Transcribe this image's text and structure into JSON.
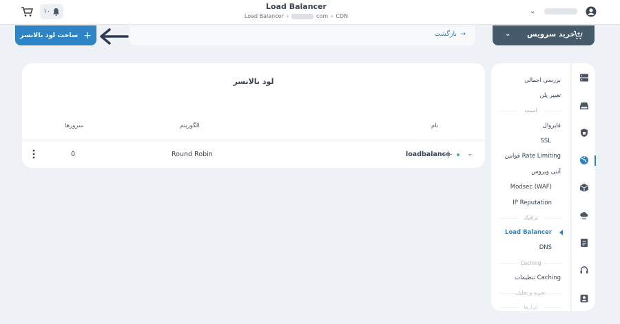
{
  "header": {
    "title": "Load Balancer",
    "breadcrumb": {
      "cdn": "CDN",
      "domain_suffix": "com",
      "current": "Load Balancer"
    },
    "notif_count": "۱۰"
  },
  "actions": {
    "create_button": "ساخت لود بالانسر",
    "back_link": "بازگشت",
    "buy_service": "خرید سرویس"
  },
  "card": {
    "title": "لود بالانسر",
    "columns": {
      "name": "نام",
      "algorithm": "الگوریتم",
      "servers": "سرورها"
    },
    "rows": [
      {
        "name": "loadbalance",
        "algorithm": "Round Robin",
        "servers": "0"
      }
    ]
  },
  "menu": {
    "overview": "بررسی اجمالی",
    "change_plan": "تغییر پلن",
    "sec_security": "امنیت",
    "firewall": "فایروال",
    "ssl": "SSL",
    "rate_limiting": "قوانین Rate Limiting",
    "antivirus": "آنتی ویروس",
    "waf": "Modsec (WAF)",
    "ip_rep": "IP Reputation",
    "sec_traffic": "ترافیک",
    "load_balancer": "Load Balancer",
    "dns": "DNS",
    "sec_caching": "Caching",
    "caching_settings": "تنظیمات Caching",
    "sec_analytics": "تجزیه و تحلیل",
    "sec_tools": "ابزارها"
  },
  "colors": {
    "accent": "#2f84c5",
    "dark": "#455a6b",
    "background": "#eef1f5"
  }
}
